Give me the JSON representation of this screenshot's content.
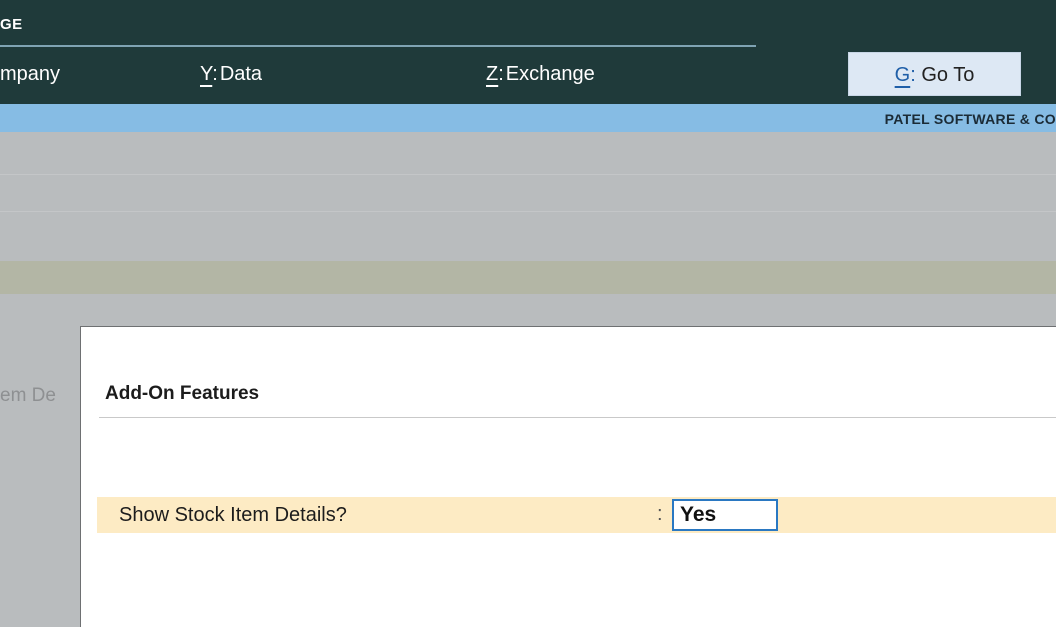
{
  "header": {
    "title": "GE",
    "menu": [
      {
        "key": "",
        "label": "mpany"
      },
      {
        "key": "Y",
        "label": "Data"
      },
      {
        "key": "Z",
        "label": "Exchange"
      }
    ],
    "goto": {
      "key": "G",
      "label": "Go To"
    }
  },
  "company": {
    "name": "PATEL SOFTWARE & CO"
  },
  "background": {
    "partial_label": "em De"
  },
  "panel": {
    "title": "Add-On Features",
    "option": {
      "label": "Show Stock Item Details?",
      "separator": ":",
      "value": "Yes"
    }
  },
  "colors": {
    "topbar": "#1f3a3a",
    "company_bar": "#86bce4",
    "highlight_row": "#fdebc4",
    "focus_border": "#2a78c2"
  }
}
